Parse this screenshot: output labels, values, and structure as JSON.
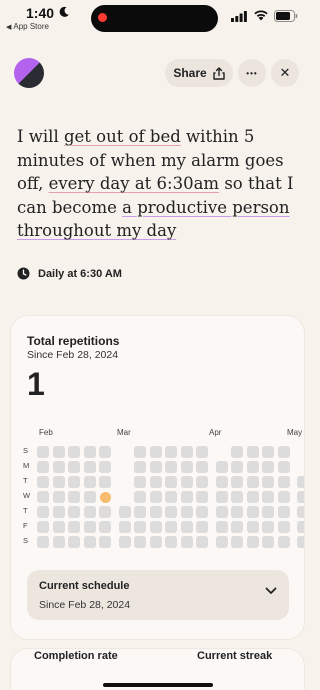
{
  "status_bar": {
    "time": "1:40",
    "back_app": "App Store"
  },
  "header": {
    "share_label": "Share",
    "more_label": "•••",
    "close_label": "✕"
  },
  "intention": {
    "parts": [
      {
        "text": "I will ",
        "style": "plain"
      },
      {
        "text": "get out of bed",
        "style": "red"
      },
      {
        "text": " within 5 minutes of when my alarm goes off, ",
        "style": "plain"
      },
      {
        "text": "every day at 6:30am",
        "style": "red"
      },
      {
        "text": " so that I can become ",
        "style": "plain"
      },
      {
        "text": "a productive person throughout my day",
        "style": "purple"
      }
    ]
  },
  "schedule_label": "Daily at 6:30 AM",
  "stats_card": {
    "title": "Total repetitions",
    "since": "Since Feb 28, 2024",
    "count": "1",
    "months": [
      "Feb",
      "Mar",
      "Apr",
      "May"
    ],
    "day_labels": [
      "S",
      "M",
      "T",
      "W",
      "T",
      "F",
      "S"
    ],
    "completed_days": [
      "Feb 28, 2024"
    ],
    "current_schedule": {
      "title": "Current schedule",
      "since": "Since Feb 28, 2024"
    }
  },
  "bottom_stats": {
    "completion_label": "Completion rate",
    "streak_label": "Current streak"
  },
  "colors": {
    "background": "#f7f2ec",
    "cell": "#dcdcdc",
    "completed": "#f7bb6e",
    "underline_red": "#e8a0a8",
    "underline_purple": "#c79be8"
  }
}
